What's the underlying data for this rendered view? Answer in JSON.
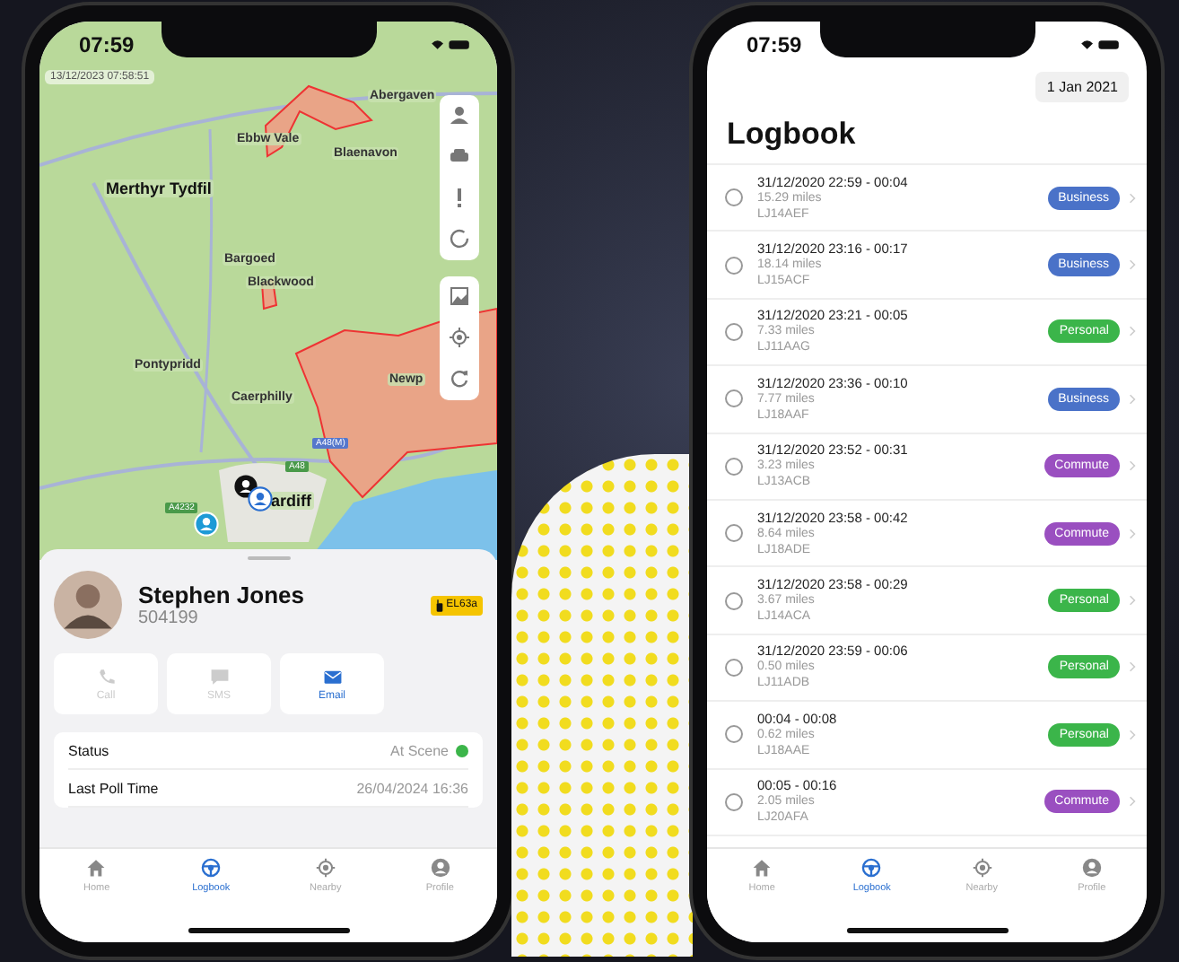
{
  "left_screen": {
    "status_bar": {
      "time": "07:59"
    },
    "map": {
      "timestamp": "13/12/2023 07:58:51",
      "places": [
        "Abergaven",
        "Ebbw Vale",
        "Blaenavon",
        "Merthyr Tydfil",
        "Bargoed",
        "Blackwood",
        "Pontypridd",
        "Caerphilly",
        "Newp",
        "ardiff"
      ],
      "roads": [
        "A48(M)",
        "A48",
        "A4232"
      ]
    },
    "contact": {
      "name": "Stephen Jones",
      "id": "504199",
      "badge": "EL63a"
    },
    "actions": [
      {
        "label": "Call",
        "kind": "phone",
        "disabled": true
      },
      {
        "label": "SMS",
        "kind": "message",
        "disabled": true
      },
      {
        "label": "Email",
        "kind": "mail",
        "disabled": false
      }
    ],
    "details": [
      {
        "label": "Status",
        "value": "At Scene",
        "color": "#3cb54a"
      },
      {
        "label": "Last Poll Time",
        "value": "26/04/2024 16:36"
      }
    ],
    "tab_bar": [
      {
        "label": "Home",
        "kind": "home",
        "selected": false
      },
      {
        "label": "Logbook",
        "kind": "wheel",
        "selected": true
      },
      {
        "label": "Nearby",
        "kind": "target",
        "selected": false
      },
      {
        "label": "Profile",
        "kind": "person",
        "selected": false
      }
    ]
  },
  "right_screen": {
    "status_bar": {
      "time": "07:59"
    },
    "date_button": "1 Jan 2021",
    "title": "Logbook",
    "trips": [
      {
        "time": "31/12/2020 22:59 - 00:04",
        "distance": "15.29 miles",
        "plate": "LJ14AEF",
        "checked": false,
        "tag": {
          "label": "Business",
          "color": "#4a72c8"
        }
      },
      {
        "time": "31/12/2020 23:16 - 00:17",
        "distance": "18.14 miles",
        "plate": "LJ15ACF",
        "checked": false,
        "tag": {
          "label": "Business",
          "color": "#4a72c8"
        }
      },
      {
        "time": "31/12/2020 23:21 - 00:05",
        "distance": "7.33 miles",
        "plate": "LJ11AAG",
        "checked": false,
        "tag": {
          "label": "Personal",
          "color": "#3bb54a"
        }
      },
      {
        "time": "31/12/2020 23:36 - 00:10",
        "distance": "7.77 miles",
        "plate": "LJ18AAF",
        "checked": false,
        "tag": {
          "label": "Business",
          "color": "#4a72c8"
        }
      },
      {
        "time": "31/12/2020 23:52 - 00:31",
        "distance": "3.23 miles",
        "plate": "LJ13ACB",
        "checked": false,
        "tag": {
          "label": "Commute",
          "color": "#9a4fc0"
        }
      },
      {
        "time": "31/12/2020 23:58 - 00:42",
        "distance": "8.64 miles",
        "plate": "LJ18ADE",
        "checked": false,
        "tag": {
          "label": "Commute",
          "color": "#9a4fc0"
        }
      },
      {
        "time": "31/12/2020 23:58 - 00:29",
        "distance": "3.67 miles",
        "plate": "LJ14ACA",
        "checked": false,
        "tag": {
          "label": "Personal",
          "color": "#3bb54a"
        }
      },
      {
        "time": "31/12/2020 23:59 - 00:06",
        "distance": "0.50 miles",
        "plate": "LJ11ADB",
        "checked": false,
        "tag": {
          "label": "Personal",
          "color": "#3bb54a"
        }
      },
      {
        "time": "00:04 - 00:08",
        "distance": "0.62 miles",
        "plate": "LJ18AAE",
        "checked": false,
        "tag": {
          "label": "Personal",
          "color": "#3bb54a"
        }
      },
      {
        "time": "00:05 - 00:16",
        "distance": "2.05 miles",
        "plate": "LJ20AFA",
        "checked": false,
        "tag": {
          "label": "Commute",
          "color": "#9a4fc0"
        }
      }
    ],
    "tab_bar": [
      {
        "label": "Home",
        "kind": "home",
        "selected": false
      },
      {
        "label": "Logbook",
        "kind": "wheel",
        "selected": true
      },
      {
        "label": "Nearby",
        "kind": "target",
        "selected": false
      },
      {
        "label": "Profile",
        "kind": "person",
        "selected": false
      }
    ]
  }
}
